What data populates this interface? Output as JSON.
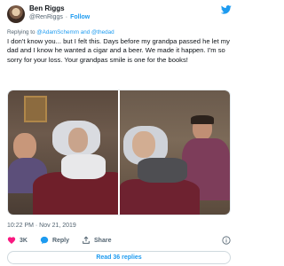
{
  "author": {
    "name": "Ben Riggs",
    "handle": "@RenRiggs",
    "separator": "·",
    "follow_label": "Follow"
  },
  "reply_context": {
    "prefix": "Replying to",
    "mentions": "@AdamSchemm and @thedad"
  },
  "tweet": {
    "text": "I don't know you... but I felt this. Days before my grandpa passed he let my dad and I know he wanted a cigar and a beer. We made it happen. I'm so sorry for your loss. Your grandpas smile is one for the books!"
  },
  "timestamp": "10:22 PM · Nov 21, 2019",
  "actions": {
    "likes_count": "3K",
    "reply_label": "Reply",
    "share_label": "Share"
  },
  "read_replies_label": "Read 36 replies",
  "colors": {
    "accent": "#1d9bf0",
    "like": "#f91880",
    "text": "#0f1419",
    "muted": "#536471"
  },
  "icons": [
    "twitter-bird-icon",
    "heart-icon",
    "reply-icon",
    "share-icon",
    "info-icon"
  ]
}
